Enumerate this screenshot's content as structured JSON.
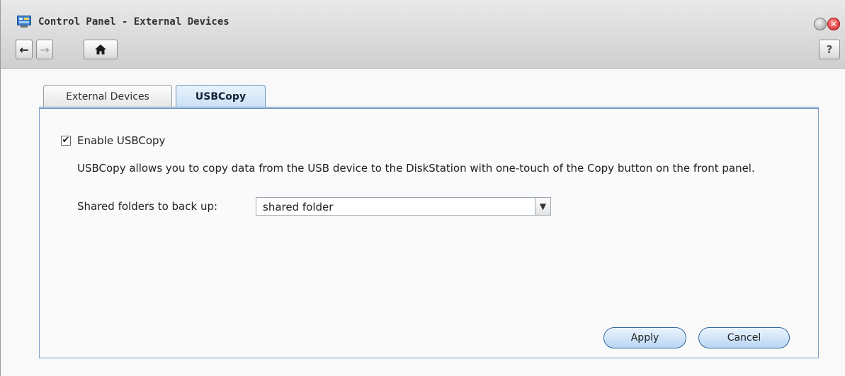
{
  "window": {
    "title": "Control Panel - External Devices",
    "close_glyph": "✕"
  },
  "toolbar": {
    "back_icon": "←",
    "forward_icon": "→",
    "help_label": "?"
  },
  "tabs": [
    {
      "label": "External Devices",
      "selected": false
    },
    {
      "label": "USBCopy",
      "selected": true
    }
  ],
  "usbcopy": {
    "enable_label": "Enable USBCopy",
    "enabled": true,
    "description": "USBCopy allows you to copy data from the USB device to the DiskStation with one-touch of the Copy button on the front panel.",
    "folders_label": "Shared folders to back up:",
    "folders_value": "shared folder"
  },
  "actions": {
    "apply_label": "Apply",
    "cancel_label": "Cancel"
  },
  "colors": {
    "accent": "#6b93bd",
    "close": "#d01e1e"
  }
}
